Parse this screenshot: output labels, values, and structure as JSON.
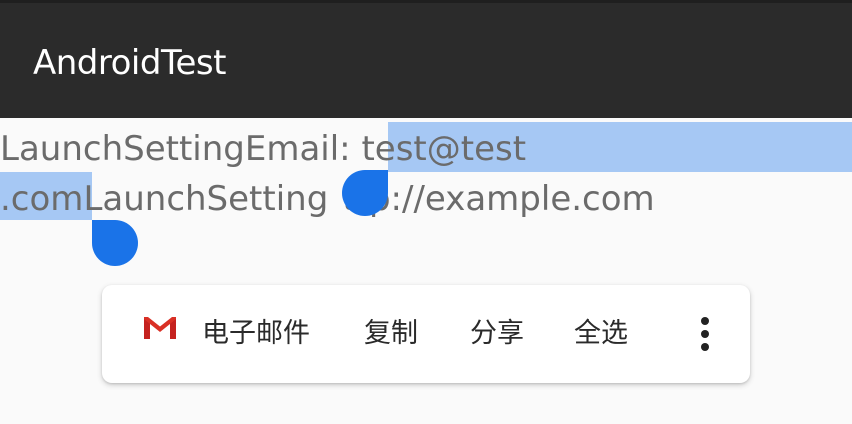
{
  "app": {
    "title": "AndroidTest"
  },
  "content": {
    "line1": {
      "prefix": "LaunchSettingEmail: ",
      "selected": "test@test"
    },
    "line2": {
      "selected": ".com",
      "rest_a": "LaunchSetting",
      "rest_b": "ttp://example.com"
    }
  },
  "selection_toolbar": {
    "email": {
      "label": "电子邮件",
      "icon": "gmail-icon"
    },
    "copy": {
      "label": "复制"
    },
    "share": {
      "label": "分享"
    },
    "select_all": {
      "label": "全选"
    },
    "more": {
      "icon": "more-vert-icon"
    }
  },
  "colors": {
    "appbar": "#2b2b2b",
    "selection_highlight": "#a6c8f4",
    "selection_handle": "#1a73e8",
    "body_text": "#6b6b6b"
  }
}
